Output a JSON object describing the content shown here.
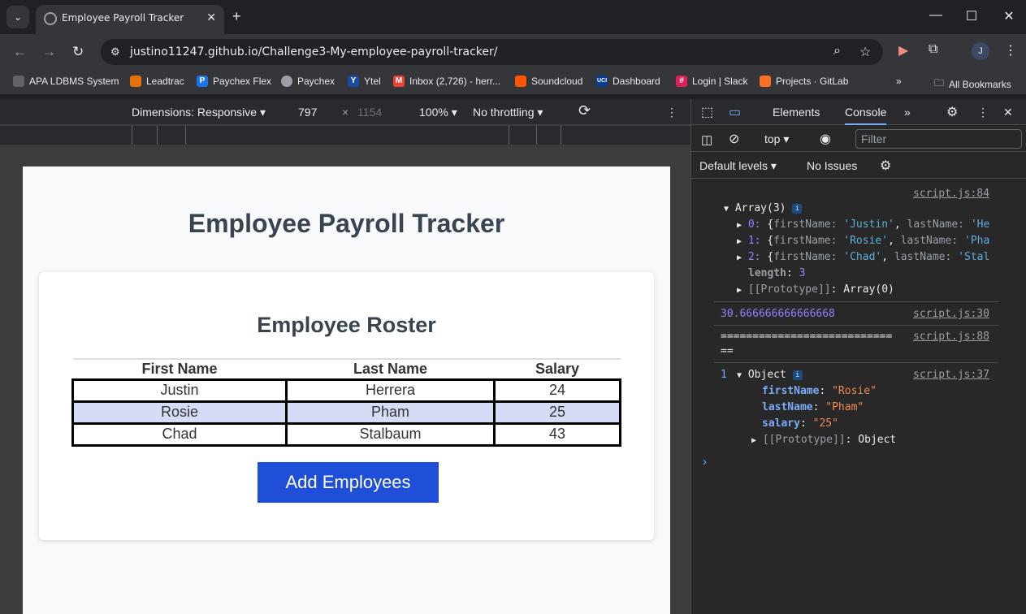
{
  "browser": {
    "tab_title": "Employee Payroll Tracker",
    "url": "justino11247.github.io/Challenge3-My-employee-payroll-tracker/",
    "avatar_letter": "J",
    "bookmarks": [
      {
        "label": "APA LDBMS System",
        "color": "#5f6368"
      },
      {
        "label": "Leadtrac",
        "color": "#e8710a"
      },
      {
        "label": "Paychex Flex",
        "color": "#1a73e8"
      },
      {
        "label": "Paychex",
        "color": "#9aa0a6"
      },
      {
        "label": "Ytel",
        "color": "#1a4b9e"
      },
      {
        "label": "Inbox (2,726) - herr...",
        "color": "#ea4335"
      },
      {
        "label": "Soundcloud",
        "color": "#ff5500"
      },
      {
        "label": "Dashboard",
        "color": "#0b3d91"
      },
      {
        "label": "Login | Slack",
        "color": "#e01e5a"
      },
      {
        "label": "Projects · GitLab",
        "color": "#fc6d26"
      }
    ],
    "all_bookmarks_label": "All Bookmarks"
  },
  "device_toolbar": {
    "dimensions_label": "Dimensions: Responsive",
    "width": "797",
    "height": "1154",
    "zoom": "100%",
    "throttling": "No throttling"
  },
  "page": {
    "title": "Employee Payroll Tracker",
    "roster_title": "Employee Roster",
    "columns": [
      "First Name",
      "Last Name",
      "Salary"
    ],
    "rows": [
      [
        "Justin",
        "Herrera",
        "24"
      ],
      [
        "Rosie",
        "Pham",
        "25"
      ],
      [
        "Chad",
        "Stalbaum",
        "43"
      ]
    ],
    "add_button": "Add Employees"
  },
  "devtools": {
    "tabs": {
      "elements": "Elements",
      "console": "Console"
    },
    "context": "top",
    "filter_placeholder": "Filter",
    "levels": "Default levels",
    "issues": "No Issues",
    "log1": {
      "source": "script.js:84",
      "header": "Array(3)",
      "items": [
        {
          "idx": "0:",
          "first": "'Justin'",
          "last": "'He"
        },
        {
          "idx": "1:",
          "first": "'Rosie'",
          "last": "'Pha"
        },
        {
          "idx": "2:",
          "first": "'Chad'",
          "last": "'Stal"
        }
      ],
      "length_key": "length",
      "length_val": "3",
      "proto": "[[Prototype]]",
      "proto_val": "Array(0)"
    },
    "log2": {
      "value": "30.666666666666668",
      "source": "script.js:30"
    },
    "log3": {
      "value": "===========================",
      "value2": "==",
      "source": "script.js:88"
    },
    "log4": {
      "count": "1",
      "header": "Object",
      "source": "script.js:37",
      "firstName": "\"Rosie\"",
      "lastName": "\"Pham\"",
      "salary": "\"25\"",
      "proto": "[[Prototype]]",
      "proto_val": "Object"
    }
  }
}
